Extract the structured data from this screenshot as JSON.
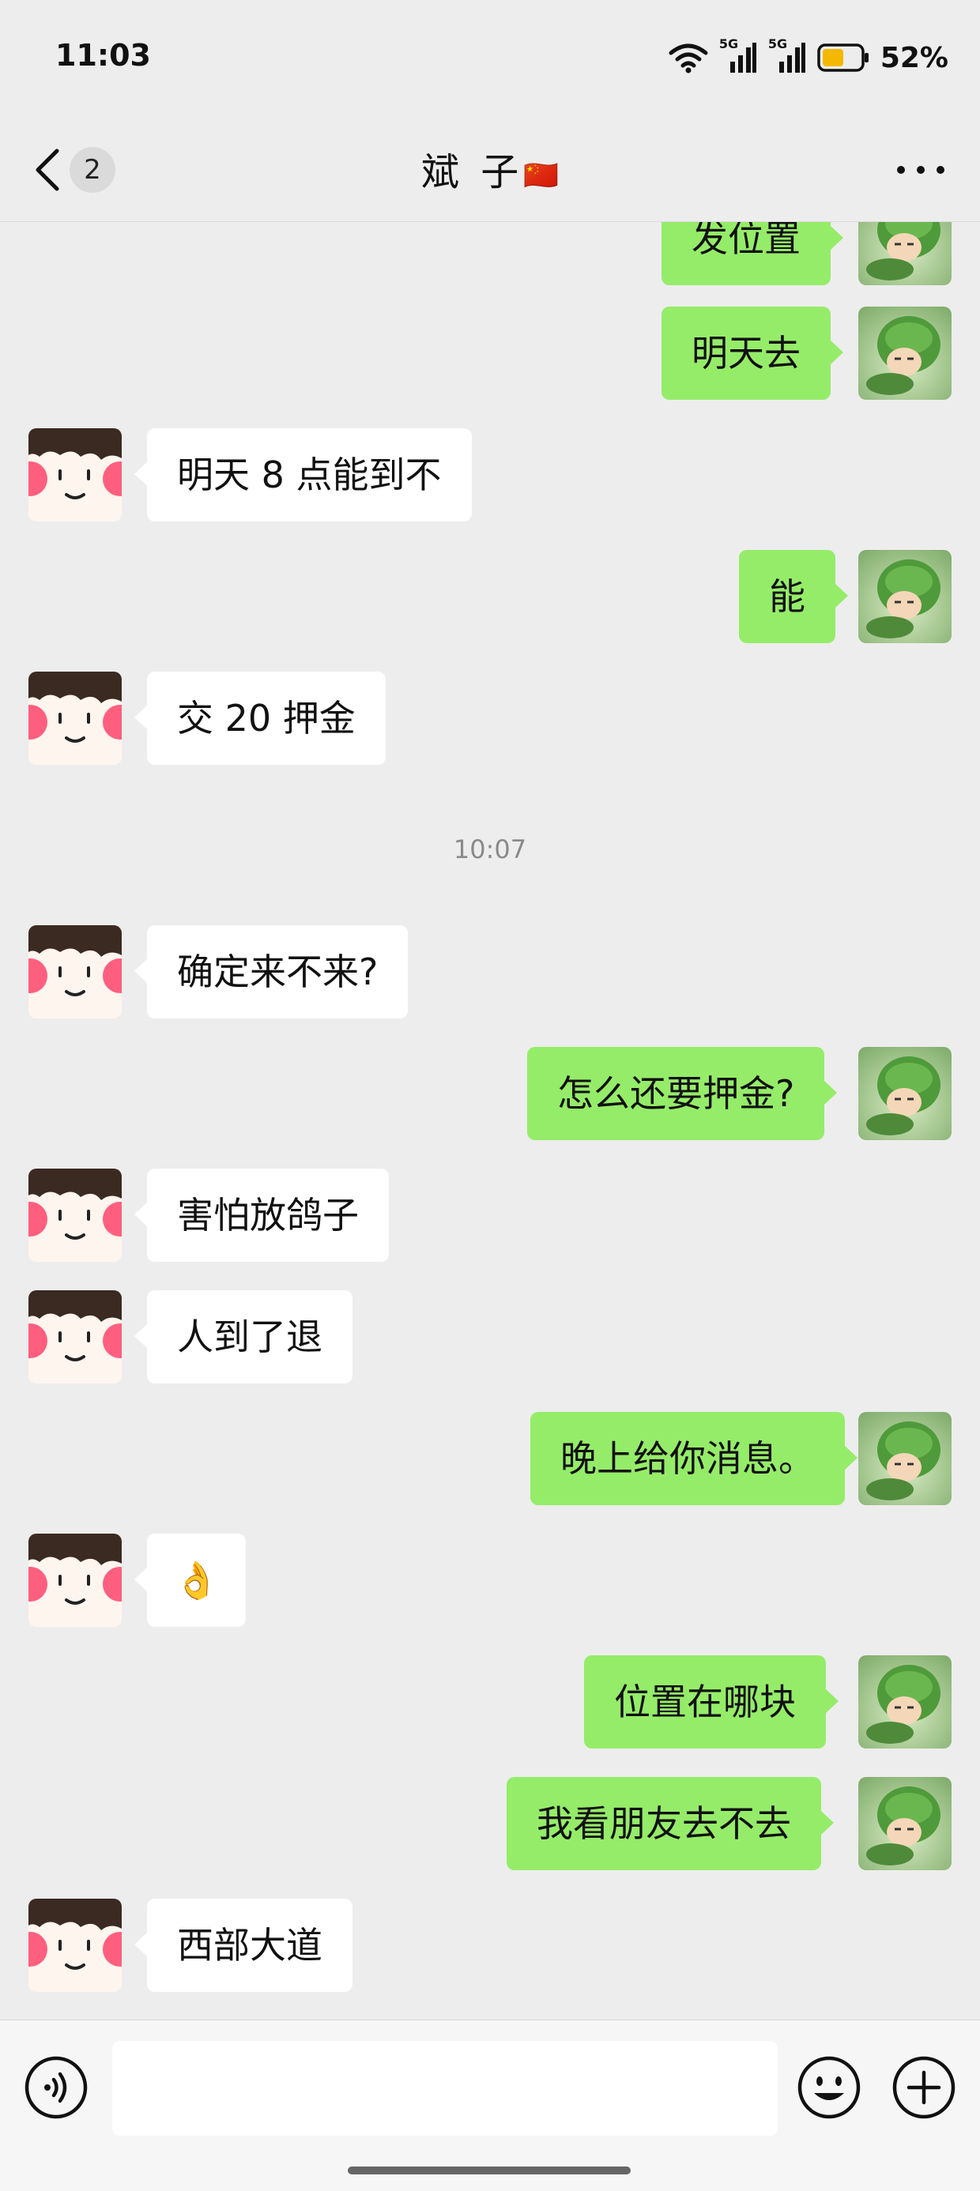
{
  "status_bar": {
    "time": "11:03",
    "network_1": "5G",
    "network_2": "5G",
    "battery": "52%"
  },
  "header": {
    "unread_count": "2",
    "title": "斌 子",
    "title_flag": "🇨🇳"
  },
  "messages": [
    {
      "side": "out",
      "text": "发位置"
    },
    {
      "side": "out",
      "text": "明天去"
    },
    {
      "side": "in",
      "text": "明天 8 点能到不"
    },
    {
      "side": "out",
      "text": "能"
    },
    {
      "side": "in",
      "text": "交 20 押金"
    },
    {
      "timestamp": "10:07"
    },
    {
      "side": "in",
      "text": "确定来不来?"
    },
    {
      "side": "out",
      "text": "怎么还要押金?"
    },
    {
      "side": "in",
      "text": "害怕放鸽子"
    },
    {
      "side": "in",
      "text": "人到了退"
    },
    {
      "side": "out",
      "text": "晚上给你消息。"
    },
    {
      "side": "in",
      "text": "👌"
    },
    {
      "side": "out",
      "text": "位置在哪块"
    },
    {
      "side": "out",
      "text": "我看朋友去不去"
    },
    {
      "side": "in",
      "text": "西部大道"
    }
  ],
  "input_bar": {
    "placeholder": "",
    "icons": [
      "voice-icon",
      "emoji-icon",
      "plus-icon"
    ]
  },
  "colors": {
    "background": "#ededed",
    "outgoing_bubble": "#95ec69",
    "incoming_bubble": "#ffffff",
    "battery_fill": "#f5b800"
  }
}
